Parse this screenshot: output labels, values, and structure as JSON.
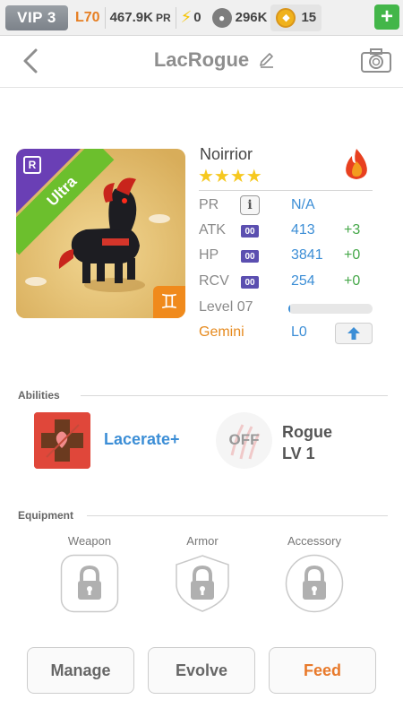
{
  "topbar": {
    "vip": "VIP 3",
    "level": "L70",
    "pr_value": "467.9K",
    "pr_unit": "PR",
    "energy": "0",
    "food": "296K",
    "coins": "15",
    "plus": "+"
  },
  "header": {
    "title": "LacRogue"
  },
  "pet": {
    "name": "Noirrior",
    "stars": "★★★★",
    "rarity": "Ultra",
    "rarity_badge": "R",
    "zodiac_symbol": "♊",
    "stats": [
      {
        "label": "PR",
        "value": "N/A",
        "bonus": ""
      },
      {
        "label": "ATK",
        "tag": "00",
        "value": "413",
        "bonus": "+3"
      },
      {
        "label": "HP",
        "tag": "00",
        "value": "3841",
        "bonus": "+0"
      },
      {
        "label": "RCV",
        "tag": "00",
        "value": "254",
        "bonus": "+0"
      }
    ],
    "level": "Level 07",
    "level_progress": 0.02,
    "zodiac": "Gemini",
    "zodiac_level": "L0"
  },
  "abilities": {
    "label": "Abilities",
    "active_name": "Lacerate+",
    "passive_state": "OFF",
    "passive_name": "Rogue",
    "passive_level": "LV 1"
  },
  "equipment": {
    "label": "Equipment",
    "slots": [
      "Weapon",
      "Armor",
      "Accessory"
    ]
  },
  "actions": {
    "manage": "Manage",
    "evolve": "Evolve",
    "feed": "Feed"
  },
  "colors": {
    "accent_blue": "#3c8ed6",
    "accent_orange": "#e8792a",
    "ultra_green": "#6cbf2d",
    "rarity_purple": "#6a3fb5"
  }
}
